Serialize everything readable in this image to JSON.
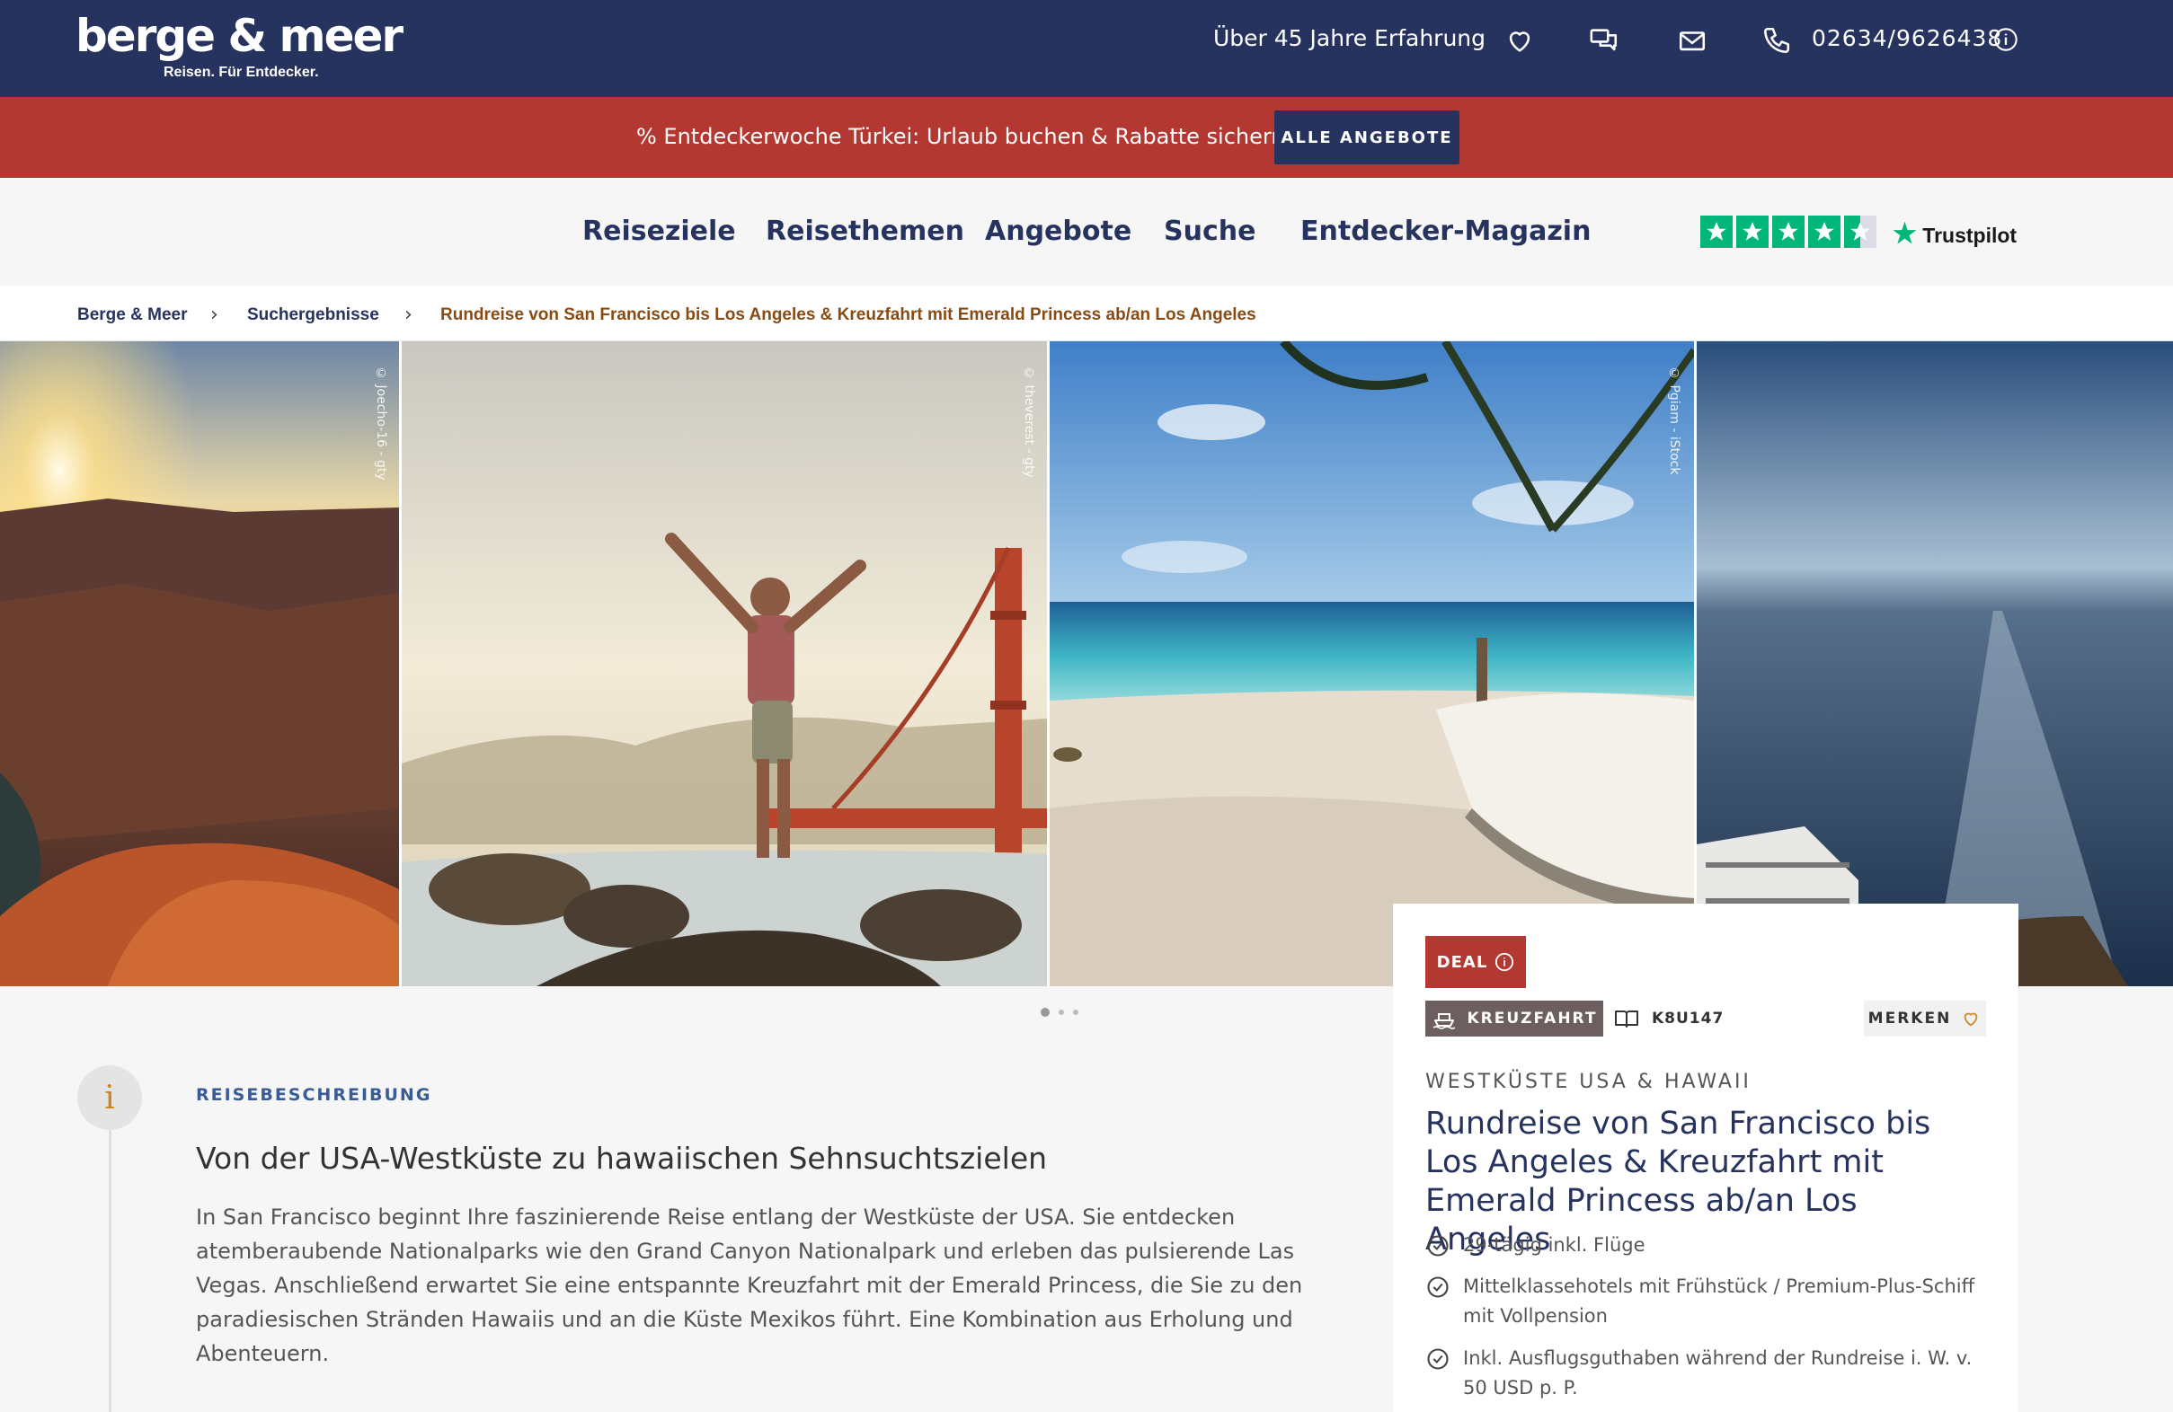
{
  "header": {
    "logo_name": "berge & meer",
    "logo_tagline": "Reisen. Für Entdecker.",
    "experience": "Über 45 Jahre Erfahrung",
    "phone": "02634/9626438",
    "icons": [
      "heart-icon",
      "chat-icon",
      "mail-icon",
      "phone-icon",
      "info-icon"
    ]
  },
  "promo": {
    "text": "% Entdeckerwoche Türkei: Urlaub buchen & Rabatte sichern!",
    "button": "ALLE ANGEBOTE"
  },
  "nav": {
    "items": [
      "Reiseziele",
      "Reisethemen",
      "Angebote",
      "Suche",
      "Entdecker-Magazin"
    ],
    "trustpilot_label": "Trustpilot",
    "trustpilot_stars": 4.5
  },
  "breadcrumb": {
    "items": [
      "Berge & Meer",
      "Suchergebnisse",
      "Rundreise von San Francisco bis Los Angeles & Kreuzfahrt mit Emerald Princess ab/an Los Angeles"
    ]
  },
  "gallery": {
    "credits": [
      "© Joecho-16 - gty",
      "© theverest - gty",
      "© Pgiam - iStock"
    ],
    "slide_count": 3,
    "active_slide": 1
  },
  "description": {
    "label": "REISEBESCHREIBUNG",
    "title": "Von der USA-Westküste zu hawaiischen Sehnsuchtszielen",
    "body": "In San Francisco beginnt Ihre faszinierende Reise entlang der Westküste der USA. Sie entdecken atemberaubende Nationalparks wie den Grand Canyon Nationalpark und erleben das pulsierende Las Vegas. Anschließend erwartet Sie eine entspannte Kreuzfahrt mit der Emerald Princess, die Sie zu den paradiesischen Stränden Hawaiis und an die Küste Mexikos führt. Eine Kombination aus Erholung und Abenteuern."
  },
  "card": {
    "deal": "DEAL",
    "type": "KREUZFAHRT",
    "code": "K8U147",
    "merken": "MERKEN",
    "region": "WESTKÜSTE USA & HAWAII",
    "title": "Rundreise von San Francisco bis Los Angeles & Kreuzfahrt mit Emerald Princess ab/an Los Angeles",
    "features": [
      "29-tägig inkl. Flüge",
      "Mittelklassehotels mit Frühstück / Premium-Plus-Schiff mit Vollpension",
      "Inkl. Ausflugsguthaben während der Rundreise i. W. v. 50 USD p. P."
    ]
  },
  "colors": {
    "navy": "#27335f",
    "promo_red": "#b23831",
    "trustpilot_green": "#00b67a",
    "breadcrumb_current": "#8a4b12"
  }
}
